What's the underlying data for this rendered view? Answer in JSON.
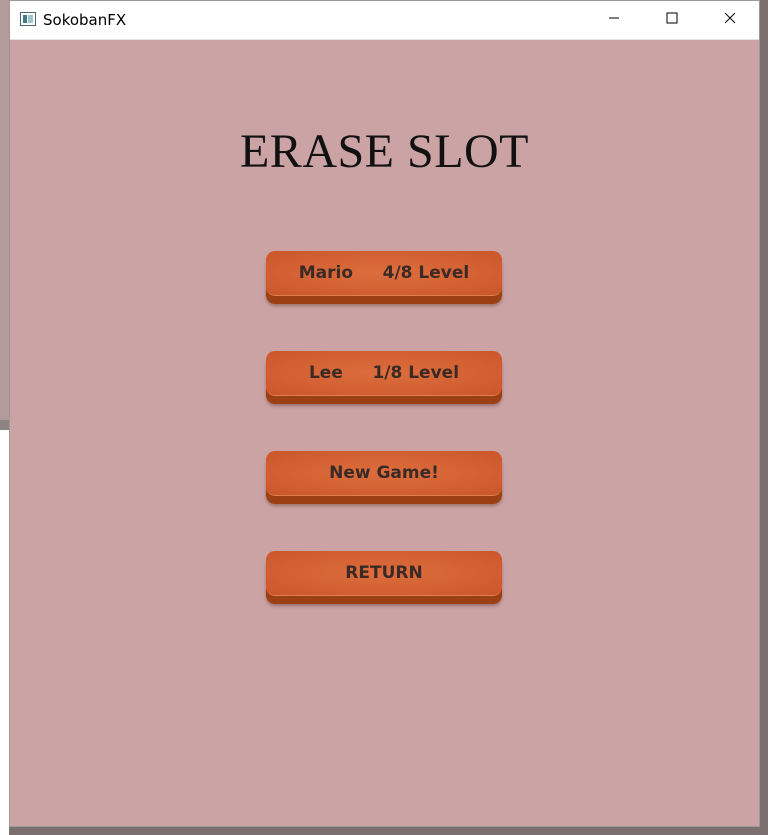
{
  "window": {
    "title": "SokobanFX",
    "icon": "app-icon",
    "controls": {
      "minimize": "minimize-icon",
      "maximize": "maximize-icon",
      "close": "close-icon"
    }
  },
  "screen": {
    "heading": "ERASE SLOT",
    "buttons": [
      {
        "label": "Mario     4/8 Level"
      },
      {
        "label": "Lee     1/8 Level"
      },
      {
        "label": "New Game!"
      },
      {
        "label": "RETURN"
      }
    ]
  },
  "colors": {
    "background": "#cba3a4",
    "button_face": "#d15e30",
    "button_shadow": "#9b3f14",
    "button_text": "#3a2a26"
  }
}
